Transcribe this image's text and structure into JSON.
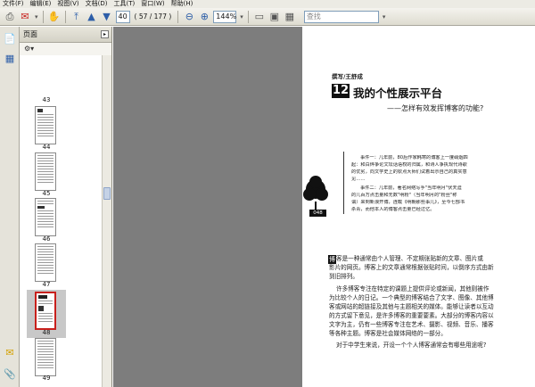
{
  "menubar": {
    "items": [
      "文件(F)",
      "编辑(E)",
      "视图(V)",
      "文档(D)",
      "工具(T)",
      "窗口(W)",
      "帮助(H)"
    ]
  },
  "toolbar": {
    "page_current": "40",
    "page_total": "( 57 / 177 )",
    "zoom": "144%",
    "search_placeholder": "查找"
  },
  "pages_panel": {
    "title": "页面",
    "thumbnails": [
      {
        "label": "43",
        "selected": false
      },
      {
        "label": "44",
        "selected": false
      },
      {
        "label": "45",
        "selected": false
      },
      {
        "label": "46",
        "selected": false
      },
      {
        "label": "47",
        "selected": false
      },
      {
        "label": "48",
        "selected": true
      },
      {
        "label": "49",
        "selected": false
      }
    ]
  },
  "document": {
    "author": "撰写/王舒成",
    "chapter_number": "12",
    "title": "我的个性展示平台",
    "subtitle": "——怎样有效发挥博客的功能?",
    "page_number": "048",
    "quote_lines": [
      "事件一：几年前，80后作家韩寒的博客上一度硝烟四",
      "起：和白烨争论文坛话语权的归属，和诗人争执现代诗歌",
      "的优劣，向文学史上的钦点大师们试着出示自己的真实意",
      "见……",
      "事件二：几年前，著名网络写手\"当年明月\"伏天涯",
      "的几百万点击量和无数\"明粉\"（当年明月的\"粉丝\"称",
      "谓）来到新浪开博，连载《明朝那些事儿》，至今七部书",
      "杀青，而他本人的博客点击量已经过亿。"
    ],
    "dropcap": "博",
    "body_lines": [
      "客是一种通常由个人管理、不定期张贴新的文章、图片或",
      "影片的网页。博客上的文章通常根据张贴时间，以倒序方式由新",
      "到旧排列。",
      "许多博客专注在特定的课题上提供评论或新闻，其他则被作",
      "为比较个人的日记。一个典型的博客结合了文字、图像、其他博",
      "客或网站的超链接及其他与主题相关的媒体。能够让读者以互动",
      "的方式留下意见，是许多博客的重要要素。大部分的博客内容以",
      "文字为主，仍有一些博客专注在艺术、摄影、视频、音乐、播客",
      "等各种主题。博客是社会媒体网络的一部分。",
      "对于中学生来说，开设一个个人博客通常会有哪些用途呢?"
    ]
  }
}
